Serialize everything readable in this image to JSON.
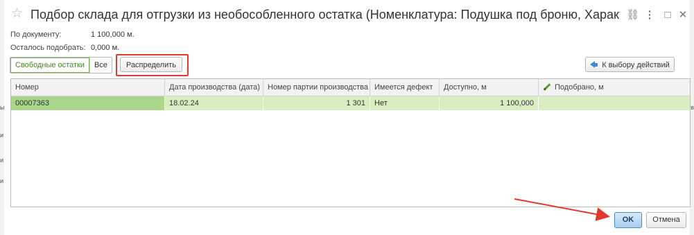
{
  "window": {
    "title": "Подбор склада для отгрузки из необособленного остатка (Номенклатура: Подушка под броню, Характеристи...",
    "star_icon": "☆",
    "link_icon": "⛓",
    "menu_icon": "⋮",
    "maximize_icon": "□",
    "close_icon": "✕"
  },
  "info": {
    "by_document_label": "По документу:",
    "by_document_value": "1 100,000 м.",
    "remaining_label": "Осталось подобрать:",
    "remaining_value": "0,000 м."
  },
  "toolbar": {
    "free_stock_label": "Свободные остатки",
    "all_label": "Все",
    "distribute_label": "Распределить",
    "to_actions_label": "К выбору действий"
  },
  "table": {
    "columns": [
      "Номер",
      "Дата производства (дата)",
      "Номер партии производства",
      "Имеется дефект",
      "Доступно, м",
      "Подобрано, м"
    ],
    "rows": [
      {
        "number": "00007363",
        "production_date": "18.02.24",
        "batch_number": "1 301",
        "has_defect": "Нет",
        "available": "1 100,000",
        "picked": ""
      }
    ]
  },
  "footer": {
    "ok_label": "OK",
    "cancel_label": "Отмена"
  },
  "colors": {
    "accent_green": "#3f8e1e",
    "selected_row": "#d9edc3",
    "selected_cell": "#a9d68a",
    "highlight_red": "#e03a2c",
    "ok_blue": "#a8cdef"
  },
  "edge": {
    "left_chars": [
      "ы",
      "и",
      "и",
      "и"
    ],
    "right_chars": [
      "в"
    ]
  }
}
